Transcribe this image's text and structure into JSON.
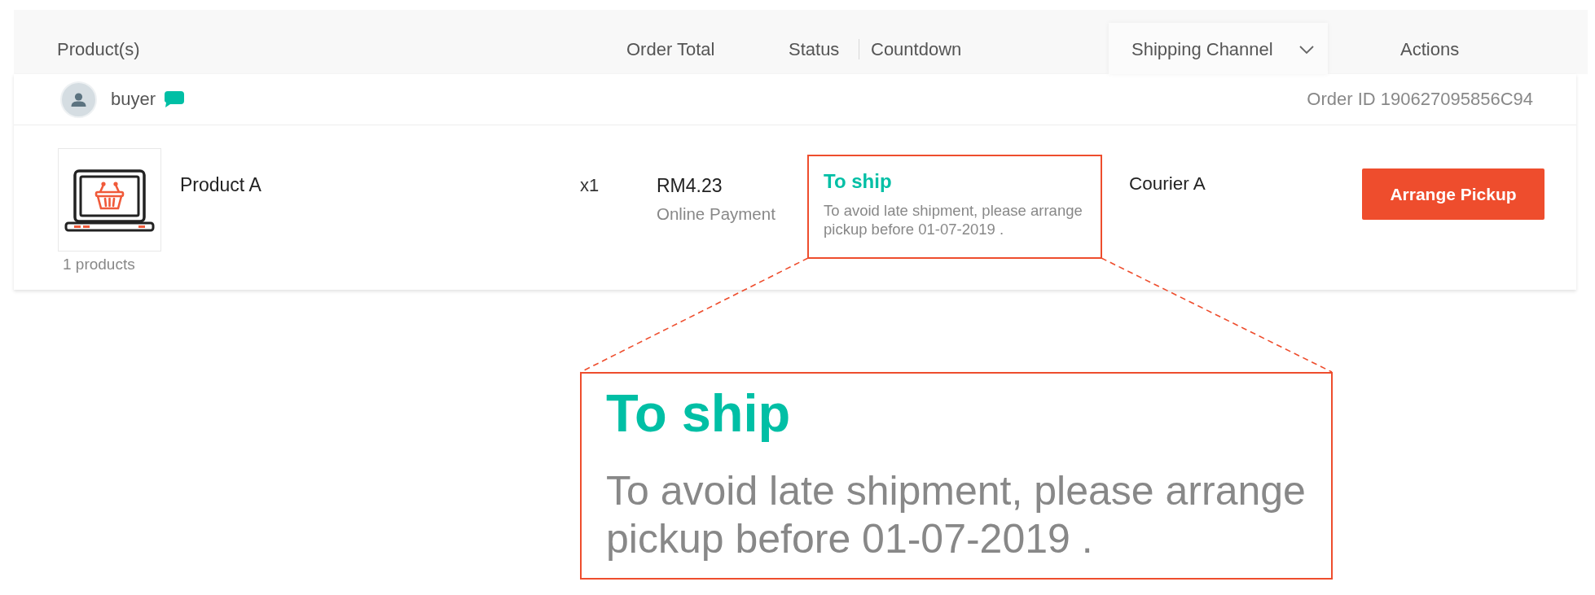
{
  "table": {
    "columns": [
      {
        "label": "Product(s)",
        "kind": "text"
      },
      {
        "label": "Order Total",
        "kind": "text"
      },
      {
        "label": "Status",
        "kind": "text"
      },
      {
        "label": "Countdown",
        "kind": "text"
      },
      {
        "label": "Shipping Channel",
        "kind": "dropdown"
      },
      {
        "label": "Actions",
        "kind": "text"
      }
    ]
  },
  "order": {
    "buyer": "buyer",
    "order_id": "Order ID 190627095856C94",
    "products": [
      {
        "name": "Product A",
        "quantity": "x1"
      }
    ],
    "product_count": "1 products",
    "total": "RM4.23",
    "payment": "Online Payment",
    "status": {
      "label": "To ship",
      "note": "To avoid late shipment, please arrange pickup before 01-07-2019 ."
    },
    "shipping_channel": "Courier A",
    "action": "Arrange Pickup"
  },
  "callout": {
    "title": "To ship",
    "text": "To avoid late shipment, please arrange pickup before 01-07-2019 ."
  }
}
